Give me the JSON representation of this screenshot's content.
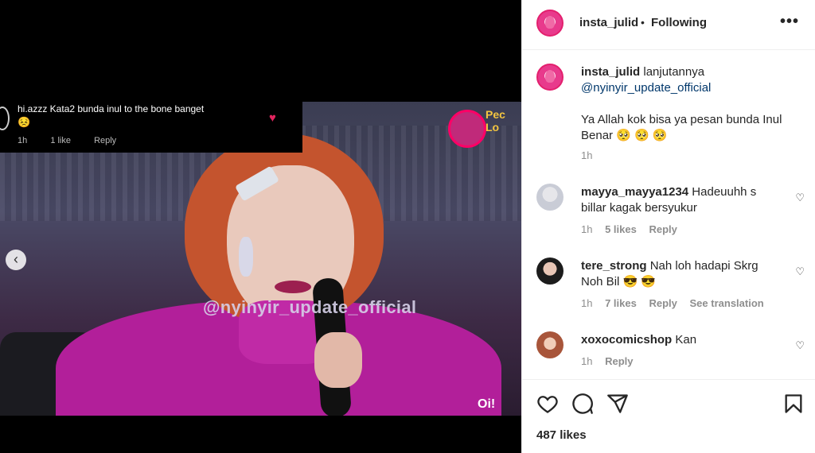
{
  "media": {
    "overlay_comment": {
      "user_text": "hi.azzz Kata2 bunda inul to the bone banget",
      "emoji": "😣",
      "time": "1h",
      "likes": "1 like",
      "reply": "Reply"
    },
    "watermark": "@nyinyir_update_official",
    "logo_text": "Pec",
    "logo_sub": "Lo",
    "corner_text": "Oi!"
  },
  "header": {
    "username": "insta_julid",
    "dot": "•",
    "follow_label": "Following",
    "more": "•••"
  },
  "caption": {
    "username": "insta_julid",
    "text": "lanjutannya",
    "mention": "@nyinyir_update_official",
    "body": "Ya Allah kok bisa ya pesan bunda Inul Benar 🥺 🥺 🥺",
    "time": "1h"
  },
  "comments": [
    {
      "username": "mayya_mayya1234",
      "text": "Hadeuuhh s billar kagak bersyukur",
      "time": "1h",
      "likes": "5 likes",
      "reply": "Reply"
    },
    {
      "username": "tere_strong",
      "text": "Nah loh hadapi Skrg Noh Bil 😎 😎",
      "time": "1h",
      "likes": "7 likes",
      "reply": "Reply",
      "translate": "See translation"
    },
    {
      "username": "xoxocomicshop",
      "text": "Kan",
      "time": "1h",
      "reply": "Reply"
    }
  ],
  "footer": {
    "likes": "487 likes"
  },
  "icons": {
    "like": "heart-icon",
    "comment": "comment-icon",
    "share": "paper-plane-icon",
    "save": "bookmark-icon",
    "prev": "chevron-left-icon"
  }
}
